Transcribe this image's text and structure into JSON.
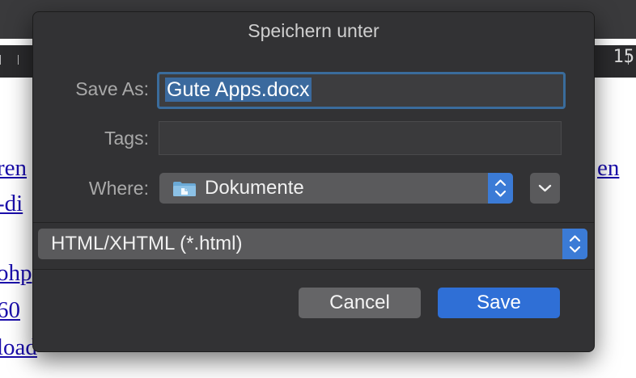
{
  "background": {
    "ruler_number": "15",
    "links": [
      "ren",
      "-di",
      "ohp",
      "60",
      "load",
      "en"
    ]
  },
  "dialog": {
    "title": "Speichern unter",
    "save_as": {
      "label": "Save As:",
      "value": "Gute Apps.docx"
    },
    "tags": {
      "label": "Tags:",
      "value": ""
    },
    "where": {
      "label": "Where:",
      "value": "Dokumente",
      "icon": "folder-icon"
    },
    "format": {
      "value": "HTML/XHTML (*.html)"
    },
    "buttons": {
      "cancel": "Cancel",
      "save": "Save"
    }
  },
  "colors": {
    "accent": "#2f6fd6",
    "dialog_bg": "#323234",
    "selection": "#3b6a9e"
  }
}
